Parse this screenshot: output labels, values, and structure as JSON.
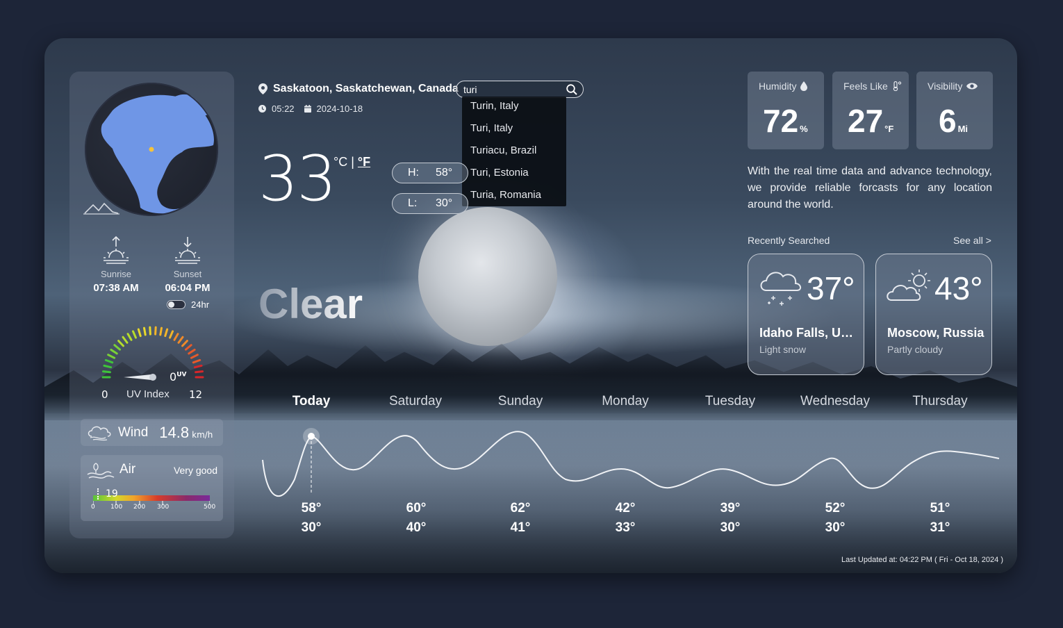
{
  "location": {
    "city": "Saskatoon, Saskatchewan, Canada",
    "time": "05:22",
    "date": "2024-10-18"
  },
  "search": {
    "value": "turi",
    "placeholder": ""
  },
  "suggestions": [
    "Turin, Italy",
    "Turi, Italy",
    "Turiacu, Brazil",
    "Turi, Estonia",
    "Turia, Romania"
  ],
  "current": {
    "temp": "33",
    "unit_c": "°C",
    "sep": "|",
    "unit_f": "°F",
    "high_label": "H:",
    "high": "58°",
    "low_label": "L:",
    "low": "30°",
    "condition": "Clear"
  },
  "sidebar": {
    "sunrise_label": "Sunrise",
    "sunrise": "07:38 AM",
    "sunset_label": "Sunset",
    "sunset": "06:04 PM",
    "toggle_label": "24hr",
    "uv": {
      "value": "0",
      "unit": "UV",
      "min": "0",
      "max": "12",
      "label": "UV Index"
    },
    "wind": {
      "label": "Wind",
      "value": "14.8",
      "unit": "km/h"
    },
    "air": {
      "label": "Air",
      "status": "Very good",
      "value": "19",
      "ticks": [
        "0",
        "100",
        "200",
        "300",
        "500"
      ]
    }
  },
  "stats": [
    {
      "label": "Humidity",
      "value": "72",
      "unit": "%",
      "icon": "droplet-icon"
    },
    {
      "label": "Feels Like",
      "value": "27",
      "unit": "°F",
      "icon": "thermometer-icon"
    },
    {
      "label": "Visibility",
      "value": "6",
      "unit": "Mi",
      "icon": "eye-icon"
    }
  ],
  "tagline": "With the real time data and advance technology, we provide reliable forcasts for any location around the world.",
  "recent": {
    "label": "Recently Searched",
    "see_all": "See all  >",
    "items": [
      {
        "city": "Idaho Falls, United States",
        "temp": "37°",
        "desc": "Light snow",
        "icon": "snow-cloud-icon"
      },
      {
        "city": "Moscow, Russia",
        "temp": "43°",
        "desc": "Partly cloudy",
        "icon": "partly-cloudy-icon"
      }
    ]
  },
  "forecast": [
    {
      "day": "Today",
      "high": "58°",
      "low": "30°"
    },
    {
      "day": "Saturday",
      "high": "60°",
      "low": "40°"
    },
    {
      "day": "Sunday",
      "high": "62°",
      "low": "41°"
    },
    {
      "day": "Monday",
      "high": "42°",
      "low": "33°"
    },
    {
      "day": "Tuesday",
      "high": "39°",
      "low": "30°"
    },
    {
      "day": "Wednesday",
      "high": "52°",
      "low": "30°"
    },
    {
      "day": "Thursday",
      "high": "51°",
      "low": "31°"
    }
  ],
  "updated": "Last Updated at: 04:22 PM ( Fri - Oct 18, 2024 )",
  "colors": {
    "page_bg": "#1d2538",
    "accent_dot": "#f5c33a"
  }
}
